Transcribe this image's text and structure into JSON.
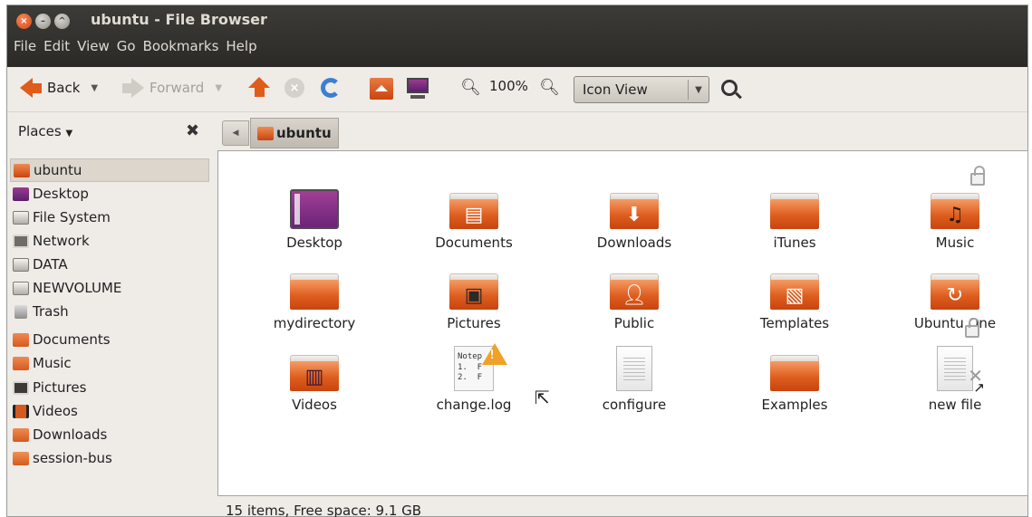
{
  "window": {
    "title": "ubuntu - File Browser"
  },
  "menubar": [
    "File",
    "Edit",
    "View",
    "Go",
    "Bookmarks",
    "Help"
  ],
  "toolbar": {
    "back_label": "Back",
    "forward_label": "Forward",
    "zoom_level": "100%",
    "view_mode": "Icon View",
    "icons": [
      "back-arrow-icon",
      "forward-arrow-icon",
      "up-arrow-icon",
      "stop-icon",
      "reload-icon",
      "home-folder-icon",
      "computer-icon",
      "zoom-out-icon",
      "zoom-in-icon",
      "search-icon"
    ]
  },
  "places": {
    "header": "Places",
    "items": [
      {
        "label": "ubuntu",
        "icon": "home-folder-icon",
        "selected": true
      },
      {
        "label": "Desktop",
        "icon": "desktop-icon"
      },
      {
        "label": "File System",
        "icon": "drive-icon"
      },
      {
        "label": "Network",
        "icon": "network-icon"
      },
      {
        "label": "DATA",
        "icon": "drive-icon"
      },
      {
        "label": "NEWVOLUME",
        "icon": "drive-icon"
      },
      {
        "label": "Trash",
        "icon": "trash-icon"
      },
      {
        "label": "Documents",
        "icon": "documents-folder-icon"
      },
      {
        "label": "Music",
        "icon": "music-folder-icon"
      },
      {
        "label": "Pictures",
        "icon": "pictures-folder-icon"
      },
      {
        "label": "Videos",
        "icon": "videos-folder-icon"
      },
      {
        "label": "Downloads",
        "icon": "downloads-folder-icon"
      },
      {
        "label": "session-bus",
        "icon": "folder-icon"
      }
    ]
  },
  "location": {
    "crumb": "ubuntu"
  },
  "files": [
    {
      "name": "Desktop",
      "icon": "desktop-icon"
    },
    {
      "name": "Documents",
      "icon": "documents-folder-icon"
    },
    {
      "name": "Downloads",
      "icon": "downloads-folder-icon"
    },
    {
      "name": "iTunes",
      "icon": "folder-icon"
    },
    {
      "name": "Music",
      "icon": "music-folder-icon"
    },
    {
      "name": "mydirectory",
      "icon": "folder-icon"
    },
    {
      "name": "Pictures",
      "icon": "pictures-folder-icon"
    },
    {
      "name": "Public",
      "icon": "public-folder-icon"
    },
    {
      "name": "Templates",
      "icon": "templates-folder-icon"
    },
    {
      "name": "Ubuntu One",
      "icon": "ubuntu-one-folder-icon"
    },
    {
      "name": "Videos",
      "icon": "videos-folder-icon"
    },
    {
      "name": "change.log",
      "icon": "text-file-icon",
      "preview": "Notep\n1.  F\n2.  F"
    },
    {
      "name": "configure",
      "icon": "text-file-icon"
    },
    {
      "name": "Examples",
      "icon": "folder-icon"
    },
    {
      "name": "new file",
      "icon": "text-file-icon"
    }
  ],
  "status": {
    "text": "15 items, Free space: 9.1 GB"
  },
  "colors": {
    "accent_orange": "#dd5d1e",
    "titlebar": "#3c3b37",
    "selection": "#dcd6cc"
  }
}
